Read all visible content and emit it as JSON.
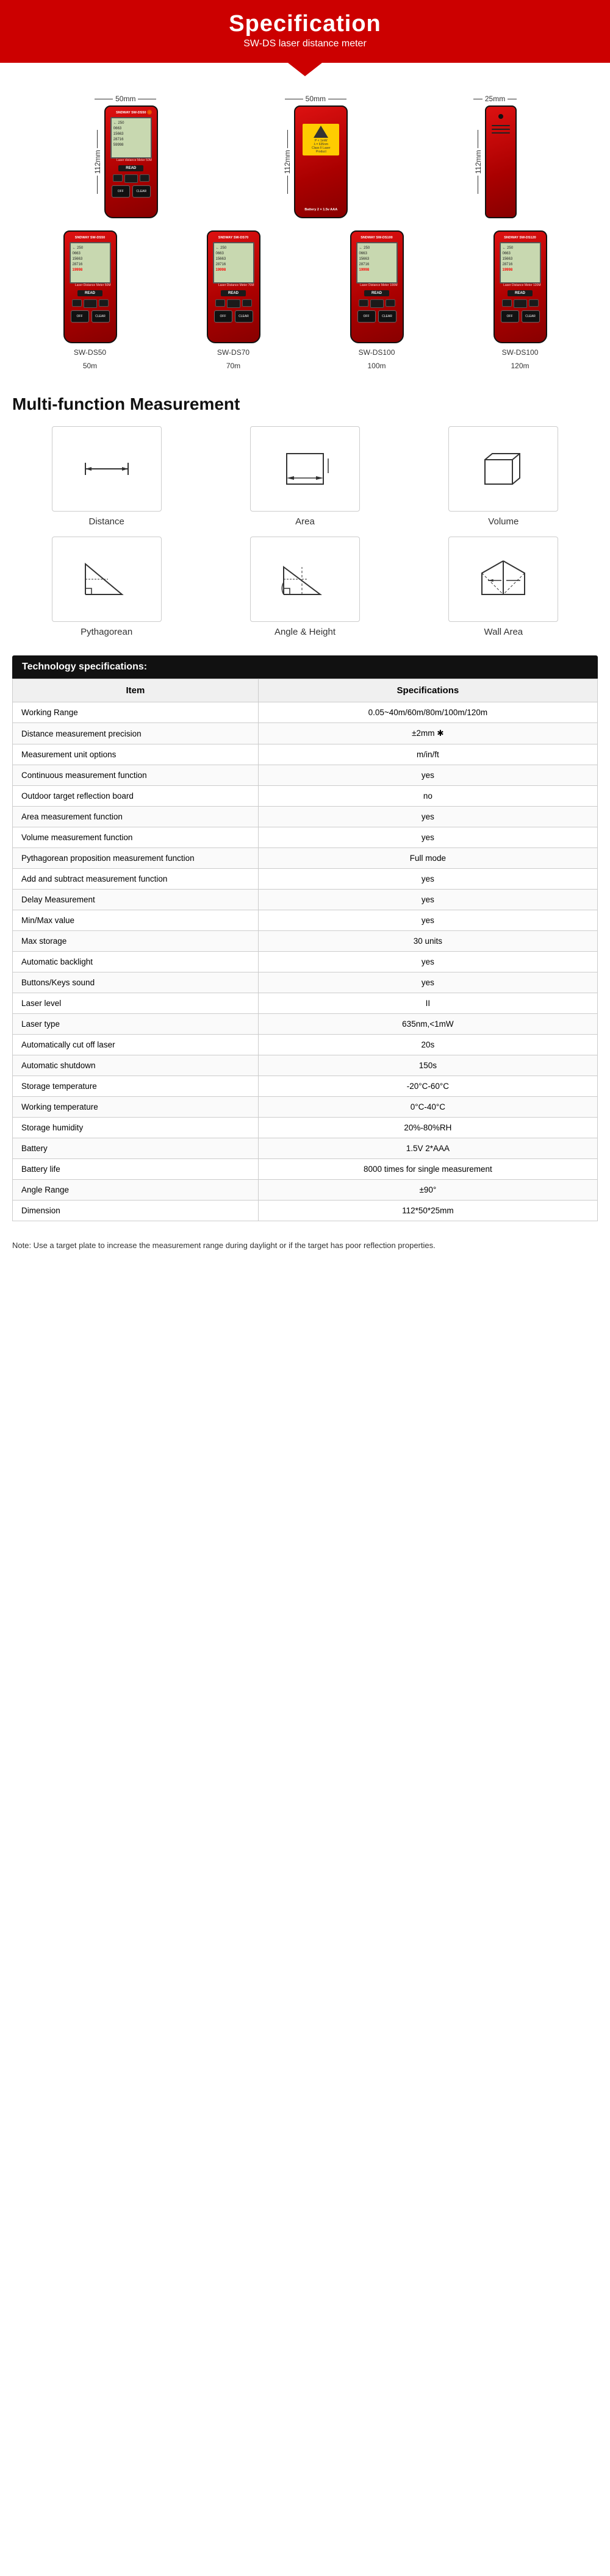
{
  "header": {
    "title": "Specification",
    "subtitle": "SW-DS laser distance meter"
  },
  "products": {
    "top_row": [
      {
        "label": "50mm",
        "side_label": "112mm",
        "type": "front"
      },
      {
        "label": "50mm",
        "side_label": "112mm",
        "type": "back"
      },
      {
        "label": "25mm",
        "side_label": "112mm",
        "type": "side"
      }
    ],
    "bottom_row": [
      {
        "model": "SW-DS50",
        "range": "50m"
      },
      {
        "model": "SW-DS70",
        "range": "70m"
      },
      {
        "model": "SW-DS100",
        "range": "100m"
      },
      {
        "model": "SW-DS100",
        "range": "120m"
      }
    ]
  },
  "multifunction": {
    "title": "Multi-function Measurement",
    "functions": [
      {
        "name": "Distance",
        "icon": "distance"
      },
      {
        "name": "Area",
        "icon": "area"
      },
      {
        "name": "Volume",
        "icon": "volume"
      },
      {
        "name": "Pythagorean",
        "icon": "pythagorean"
      },
      {
        "name": "Angle & Height",
        "icon": "angle-height"
      },
      {
        "name": "Wall Area",
        "icon": "wall-area"
      }
    ]
  },
  "specs": {
    "header": "Technology specifications:",
    "columns": [
      "Item",
      "Specifications"
    ],
    "rows": [
      {
        "item": "Working Range",
        "spec": "0.05~40m/60m/80m/100m/120m"
      },
      {
        "item": "Distance measurement precision",
        "spec": "±2mm ✱"
      },
      {
        "item": "Measurement unit options",
        "spec": "m/in/ft"
      },
      {
        "item": "Continuous measurement function",
        "spec": "yes"
      },
      {
        "item": "Outdoor target reflection board",
        "spec": "no"
      },
      {
        "item": "Area measurement function",
        "spec": "yes"
      },
      {
        "item": "Volume measurement function",
        "spec": "yes"
      },
      {
        "item": "Pythagorean proposition measurement function",
        "spec": "Full mode"
      },
      {
        "item": "Add and subtract measurement function",
        "spec": "yes"
      },
      {
        "item": "Delay Measurement",
        "spec": "yes"
      },
      {
        "item": "Min/Max value",
        "spec": "yes"
      },
      {
        "item": "Max storage",
        "spec": "30 units"
      },
      {
        "item": "Automatic backlight",
        "spec": "yes"
      },
      {
        "item": "Buttons/Keys sound",
        "spec": "yes"
      },
      {
        "item": "Laser level",
        "spec": "II"
      },
      {
        "item": "Laser type",
        "spec": "635nm,<1mW"
      },
      {
        "item": "Automatically cut off laser",
        "spec": "20s"
      },
      {
        "item": "Automatic shutdown",
        "spec": "150s"
      },
      {
        "item": "Storage temperature",
        "spec": "-20°C-60°C"
      },
      {
        "item": "Working temperature",
        "spec": "0°C-40°C"
      },
      {
        "item": "Storage humidity",
        "spec": "20%-80%RH"
      },
      {
        "item": "Battery",
        "spec": "1.5V 2*AAA"
      },
      {
        "item": "Battery life",
        "spec": "8000 times for single measurement"
      },
      {
        "item": "Angle Range",
        "spec": "±90°"
      },
      {
        "item": "Dimension",
        "spec": "112*50*25mm"
      }
    ]
  },
  "note": "Note: Use a target plate to increase the measurement range during daylight or if the target has poor reflection properties."
}
